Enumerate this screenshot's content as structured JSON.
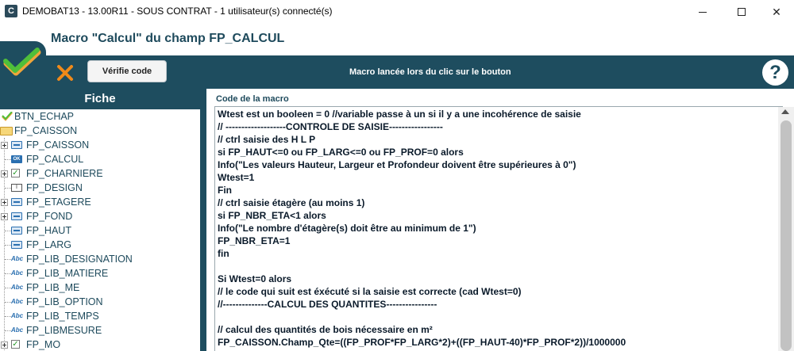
{
  "window": {
    "app_icon_letter": "C",
    "title": "DEMOBAT13 - 13.00R11 - SOUS CONTRAT - 1 utilisateur(s) connecté(s)",
    "minimize_glyph": "",
    "maximize_glyph": "",
    "close_glyph": "✕"
  },
  "header": {
    "title": "Macro \"Calcul\" du champ FP_CALCUL"
  },
  "toolbar": {
    "verify_label": "Vérifie code",
    "caption": "Macro lancée lors du clic sur le bouton",
    "help_glyph": "?",
    "accent_color": "#1e4d5f"
  },
  "fiche": {
    "title": "Fiche",
    "items": [
      {
        "label": "BTN_ECHAP",
        "icon": "button-icon"
      },
      {
        "label": "FP_CAISSON",
        "icon": "folder-icon"
      },
      {
        "label": "FP_CAISSON",
        "icon": "field-icon"
      },
      {
        "label": "FP_CALCUL",
        "icon": "ok-button-icon",
        "icon_text": "OK"
      },
      {
        "label": "FP_CHARNIERE",
        "icon": "checkbox-icon",
        "icon_text": "✓"
      },
      {
        "label": "FP_DESIGN",
        "icon": "design-icon",
        "icon_text": "I"
      },
      {
        "label": "FP_ETAGERE",
        "icon": "field-icon"
      },
      {
        "label": "FP_FOND",
        "icon": "field-icon"
      },
      {
        "label": "FP_HAUT",
        "icon": "field-icon"
      },
      {
        "label": "FP_LARG",
        "icon": "field-icon"
      },
      {
        "label": "FP_LIB_DESIGNATION",
        "icon": "text-abc-icon",
        "icon_text": "Abc"
      },
      {
        "label": "FP_LIB_MATIERE",
        "icon": "text-abc-icon",
        "icon_text": "Abc"
      },
      {
        "label": "FP_LIB_ME",
        "icon": "text-abc-icon",
        "icon_text": "Abc"
      },
      {
        "label": "FP_LIB_OPTION",
        "icon": "text-abc-icon",
        "icon_text": "Abc"
      },
      {
        "label": "FP_LIB_TEMPS",
        "icon": "text-abc-icon",
        "icon_text": "Abc"
      },
      {
        "label": "FP_LIBMESURE",
        "icon": "text-abc-icon",
        "icon_text": "Abc"
      },
      {
        "label": "FP_MO",
        "icon": "checkbox-icon",
        "icon_text": "✓"
      }
    ]
  },
  "code": {
    "label": "Code de la macro",
    "lines": [
      "Wtest est un booleen = 0 //variable  passe à un si il y a une incohérence de saisie",
      "// -------------------CONTROLE DE SAISIE-----------------",
      "// ctrl saisie des H L P",
      "si FP_HAUT<=0 ou FP_LARG<=0 ou FP_PROF=0 alors",
      "Info(\"Les valeurs Hauteur, Largeur et Profondeur doivent être supérieures à 0\")",
      "Wtest=1",
      "Fin",
      "// ctrl saisie étagère (au moins 1)",
      "si FP_NBR_ETA<1 alors",
      "Info(\"Le nombre d'étagère(s) doit être au minimum de 1\")",
      "FP_NBR_ETA=1",
      "fin",
      "",
      "Si Wtest=0 alors",
      "// le code qui suit est éxécuté si la saisie est correcte (cad Wtest=0)",
      "//--------------CALCUL DES QUANTITES----------------",
      "",
      "// calcul des quantités de bois nécessaire en m²",
      "FP_CAISSON.Champ_Qte=((FP_PROF*FP_LARG*2)+((FP_HAUT-40)*FP_PROF*2))/1000000"
    ]
  }
}
